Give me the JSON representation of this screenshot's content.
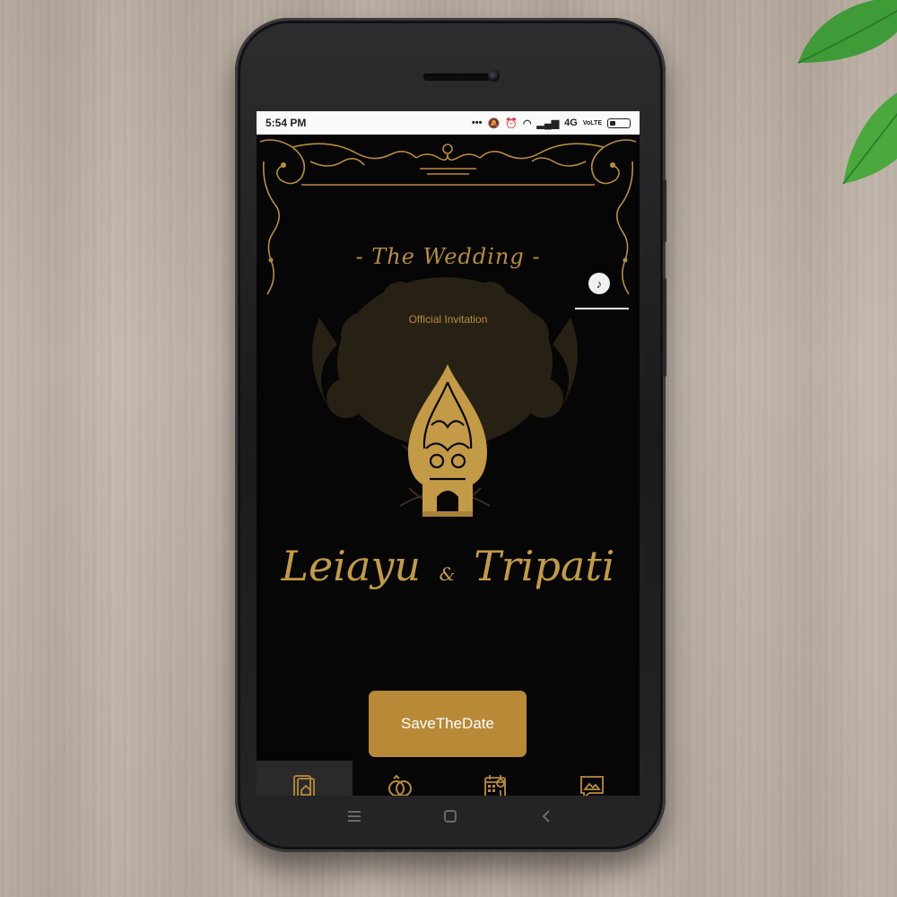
{
  "status": {
    "time": "5:54 PM",
    "dots": "•••",
    "network": "4G",
    "volte": "VoLTE"
  },
  "invitation": {
    "heading": "- The Wedding -",
    "subheading": "Official Invitation",
    "bride": "Leiayu",
    "ampersand": "&",
    "groom": "Tripati",
    "cta_label": "SaveTheDate",
    "music_icon": "music-note-icon"
  },
  "nav": {
    "items": [
      {
        "icon": "home-card-icon",
        "active": true
      },
      {
        "icon": "rings-icon",
        "active": false
      },
      {
        "icon": "calendar-location-icon",
        "active": false
      },
      {
        "icon": "gallery-message-icon",
        "active": false
      }
    ]
  },
  "softkeys": [
    "menu-icon",
    "home-icon",
    "back-icon"
  ],
  "colors": {
    "gold": "#b98c3a",
    "button": "#b88a37",
    "screen_bg": "#060606"
  }
}
